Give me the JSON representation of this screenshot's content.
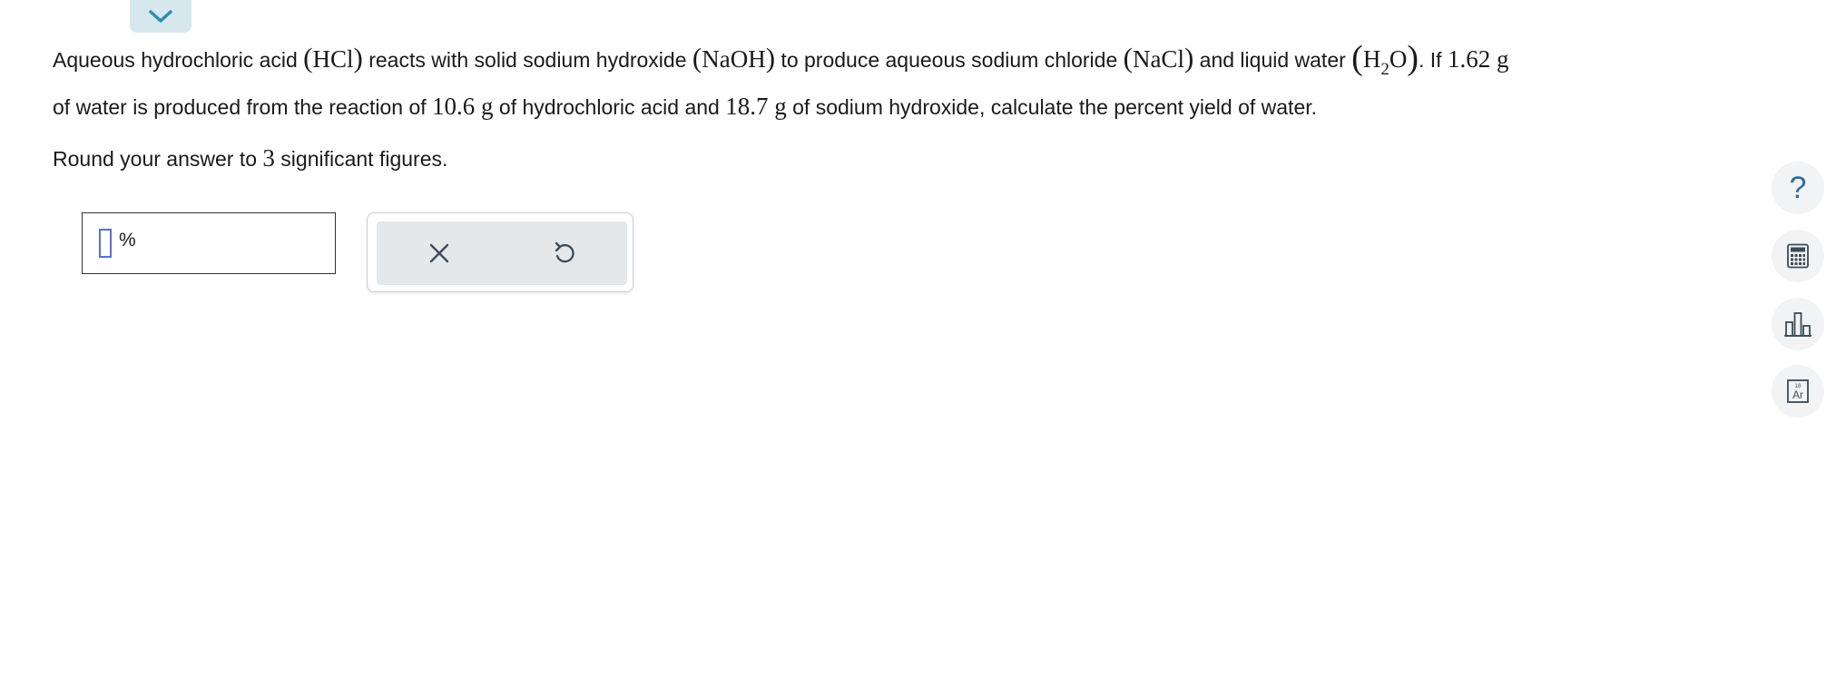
{
  "question": {
    "line1_a": "Aqueous hydrochloric acid ",
    "hcl": "HCl",
    "line1_b": " reacts with solid sodium hydroxide ",
    "naoh": "NaOH",
    "line1_c": " to produce aqueous sodium chloride ",
    "nacl": "NaCl",
    "line1_d": " and liquid water ",
    "water_h": "H",
    "water_sub": "2",
    "water_o": "O",
    "line1_e": ". If ",
    "water_mass": "1.62 g",
    "line2_a": "of water is produced from the reaction of ",
    "hcl_mass": "10.6 g",
    "line2_b": " of hydrochloric acid and ",
    "naoh_mass": "18.7 g",
    "line2_c": " of sodium hydroxide, calculate the percent yield of water."
  },
  "instruction": {
    "prefix": "Round your answer to ",
    "sig_figs": "3",
    "suffix": " significant figures."
  },
  "answer": {
    "value": "",
    "unit": "%"
  },
  "actions": {
    "clear_icon": "x-icon",
    "undo_icon": "undo-icon"
  },
  "toolbar": {
    "help_label": "?",
    "help_icon": "question-icon",
    "calculator_icon": "calculator-icon",
    "data_icon": "bar-chart-icon",
    "periodic_table_icon": "periodic-table-icon",
    "periodic_number": "18",
    "periodic_symbol": "Ar"
  },
  "colors": {
    "accent": "#2f6c9e",
    "cursor": "#5b6dd8",
    "tab_bg": "#d6e8ee",
    "panel_bg": "#e4e8eb"
  }
}
